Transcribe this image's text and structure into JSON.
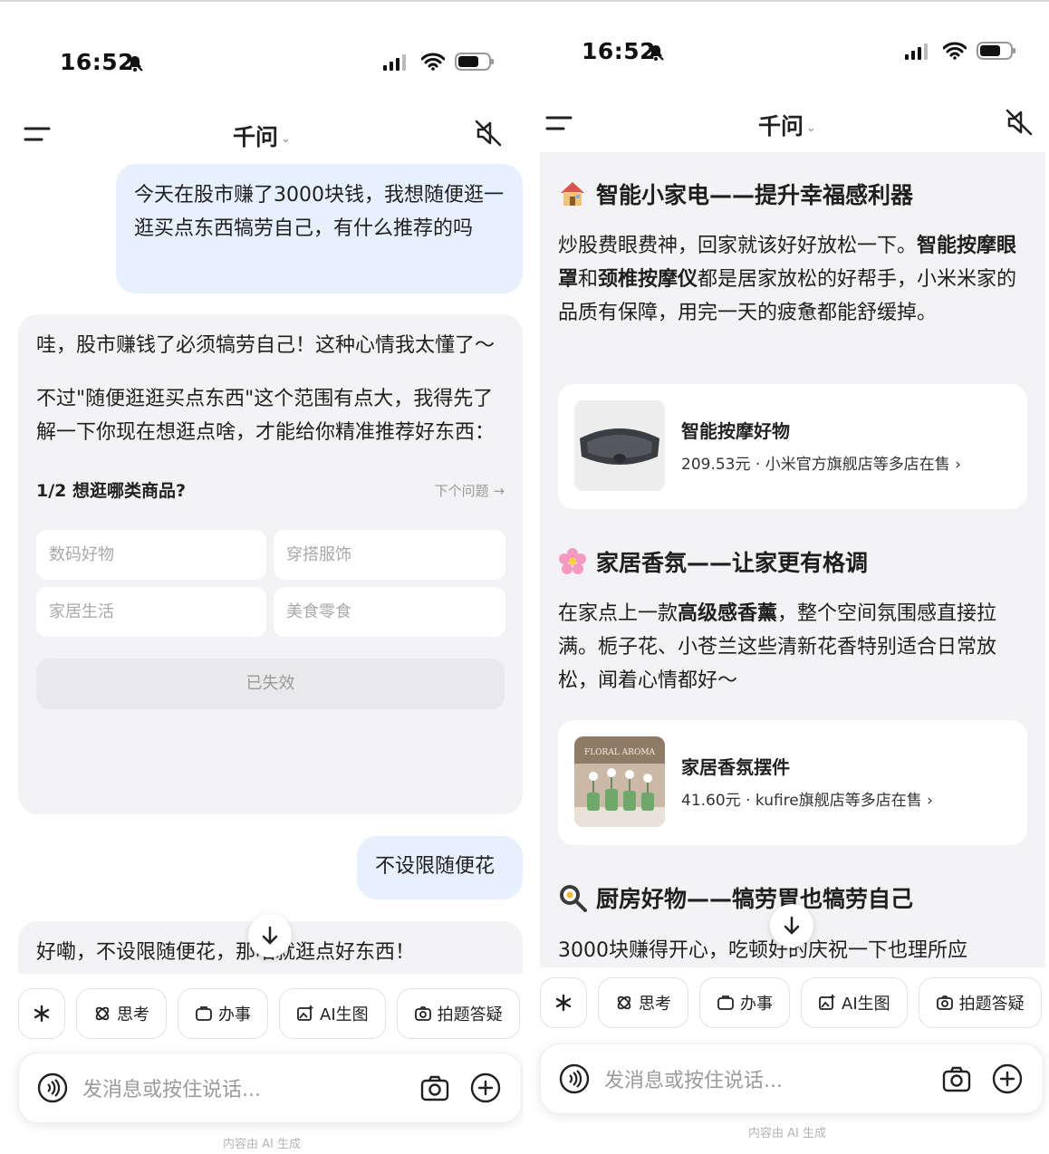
{
  "left": {
    "status": {
      "time": "16:52"
    },
    "nav": {
      "title": "千问"
    },
    "user_msg_1": "今天在股市赚了3000块钱，我想随便逛一逛买点东西犒劳自己，有什么推荐的吗",
    "ai_msg_1": {
      "para1": "哇，股市赚钱了必须犒劳自己！这种心情我太懂了～",
      "para2": "不过\"随便逛逛买点东西\"这个范围有点大，我得先了解一下你现在想逛点啥，才能给你精准推荐好东西：",
      "question_title": "1/2 想逛哪类商品?",
      "next_question": "下个问题 →",
      "options": [
        "数码好物",
        "穿搭服饰",
        "家居生活",
        "美食零食"
      ],
      "expired_label": "已失效"
    },
    "user_msg_2": "不设限随便花",
    "ai_msg_2_partial": "好嘞，不设限随便花，那咱就逛点好东西！",
    "tools": [
      "思考",
      "办事",
      "AI生图",
      "拍题答疑"
    ],
    "input_placeholder": "发消息或按住说话...",
    "footnote": "内容由 AI 生成"
  },
  "right": {
    "status": {
      "time": "16:52"
    },
    "nav": {
      "title": "千问"
    },
    "sections": [
      {
        "heading": "智能小家电——提升幸福感利器",
        "icon": "house-emoji",
        "body_parts": [
          {
            "t": "炒股费眼费神，回家就该好好放松一下。",
            "b": false
          },
          {
            "t": "智能按摩眼罩",
            "b": true
          },
          {
            "t": "和",
            "b": false
          },
          {
            "t": "颈椎按摩仪",
            "b": true
          },
          {
            "t": "都是居家放松的好帮手，小米米家的品质有保障，用完一天的疲惫都能舒缓掉。",
            "b": false
          }
        ],
        "product": {
          "name": "智能按摩好物",
          "meta": "209.53元 · 小米官方旗舰店等多店在售 ›"
        }
      },
      {
        "heading": "家居香氛——让家更有格调",
        "icon": "flower-emoji",
        "body_parts": [
          {
            "t": "在家点上一款",
            "b": false
          },
          {
            "t": "高级感香薰",
            "b": true
          },
          {
            "t": "，整个空间氛围感直接拉满。栀子花、小苍兰这些清新花香特别适合日常放松，闻着心情都好～",
            "b": false
          }
        ],
        "product": {
          "name": "家居香氛摆件",
          "meta": "41.60元 · kufire旗舰店等多店在售 ›",
          "thumb_text": "FLORAL AROMA"
        }
      },
      {
        "heading": "厨房好物——犒劳胃也犒劳自己",
        "icon": "pan-emoji",
        "body_parts": [
          {
            "t": "3000块赚得开心，吃顿好的庆祝一下也理所应",
            "b": false
          }
        ]
      }
    ],
    "tools": [
      "思考",
      "办事",
      "AI生图",
      "拍题答疑"
    ],
    "input_placeholder": "发消息或按住说话...",
    "footnote": "内容由 AI 生成"
  }
}
